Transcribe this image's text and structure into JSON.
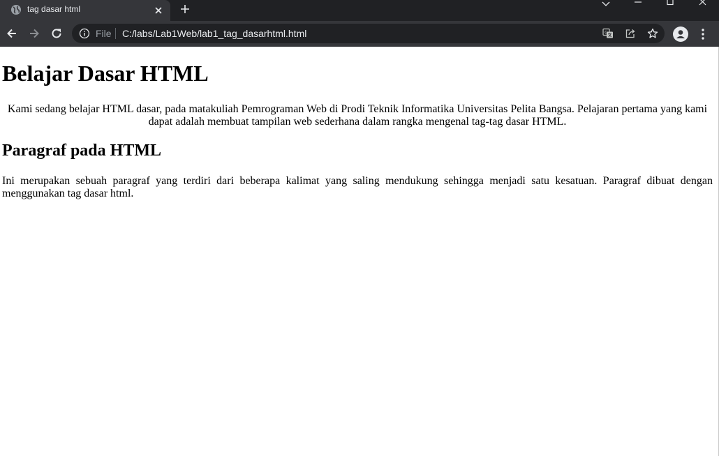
{
  "browser": {
    "tab": {
      "title": "tag dasar html",
      "favicon": "globe-icon"
    },
    "address_bar": {
      "scheme_label": "File",
      "url": "C:/labs/Lab1Web/lab1_tag_dasarhtml.html"
    },
    "colors": {
      "tabbar_bg": "#202124",
      "toolbar_bg": "#35363a",
      "omnibox_bg": "#202124",
      "icon_color": "#e8eaed"
    }
  },
  "page": {
    "heading": "Belajar Dasar HTML",
    "intro_paragraph": "Kami sedang belajar HTML dasar, pada matakuliah Pemrograman Web di Prodi Teknik Informatika Universitas Pelita Bangsa. Pelajaran pertama yang kami dapat adalah membuat tampilan web sederhana dalam rangka mengenal tag-tag dasar HTML.",
    "subheading": "Paragraf pada HTML",
    "body_paragraph": "Ini merupakan sebuah paragraf yang terdiri dari beberapa kalimat yang saling mendukung sehingga menjadi satu kesatuan. Paragraf dibuat dengan menggunakan tag dasar html."
  }
}
